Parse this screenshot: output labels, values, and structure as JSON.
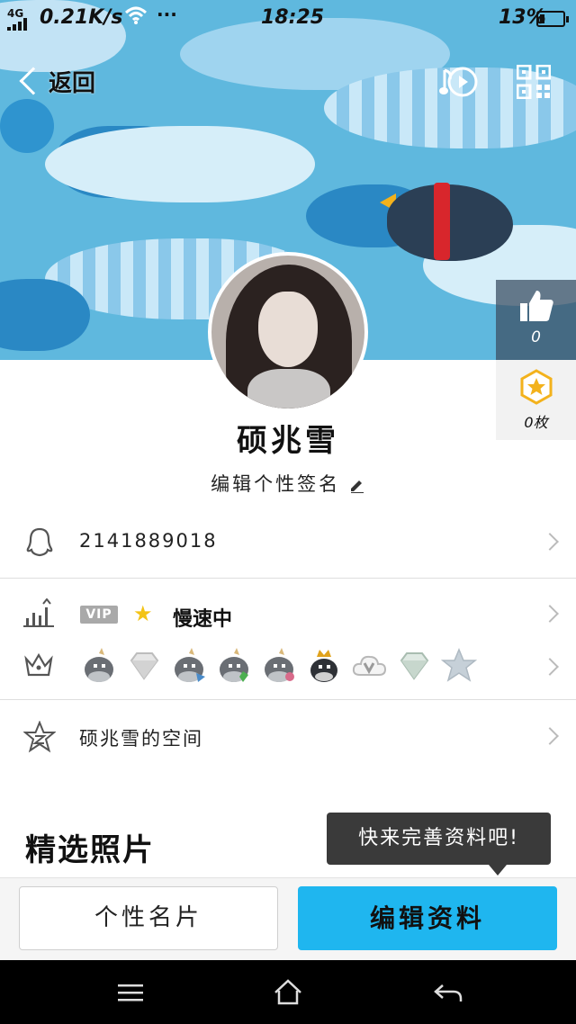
{
  "status_bar": {
    "network": "4G",
    "speed": "0.21K/s",
    "time": "18:25",
    "battery": "13%",
    "more": "···"
  },
  "header": {
    "back_label": "返回"
  },
  "profile": {
    "name": "硕兆雪",
    "signature": "编辑个性签名",
    "likes": "0",
    "medals": "0枚"
  },
  "rows": {
    "qq_number": "2141889018",
    "vip_tag": "VIP",
    "vip_status": "慢速中",
    "zone": "硕兆雪的空间"
  },
  "photos": {
    "section_title": "精选照片",
    "tooltip": "快来完善资料吧!"
  },
  "actions": {
    "card_button": "个性名片",
    "edit_button": "编辑资料"
  },
  "colors": {
    "accent": "#1fb6ef",
    "banner": "#5fb8de",
    "scarf": "#d8262c"
  }
}
